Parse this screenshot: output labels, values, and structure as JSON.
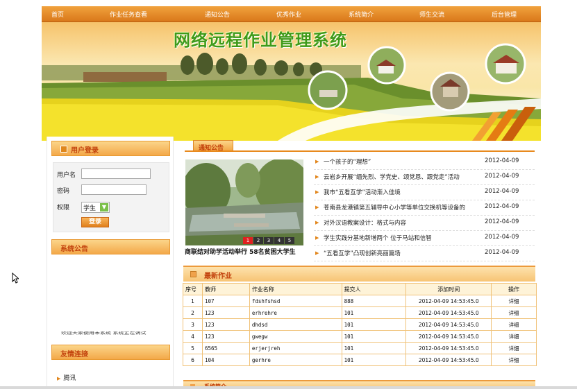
{
  "nav": {
    "items": [
      "首页",
      "作业任务查看",
      "通知公告",
      "优秀作业",
      "系统简介",
      "师生交流",
      "后台管理"
    ]
  },
  "banner": {
    "title": "网络远程作业管理系统"
  },
  "login": {
    "title": "用户登录",
    "username_label": "用户名",
    "password_label": "密码",
    "role_label": "权限",
    "role_value": "学生",
    "button": "登录"
  },
  "system_notice": {
    "title": "系统公告",
    "text": "欢迎大家使用本系统   系统正在调试"
  },
  "links": {
    "title": "友情连接",
    "items": [
      "腾讯"
    ]
  },
  "notice": {
    "tab": "通知公告",
    "photo_caption": "商联结对助学活动举行 58名贫困大学生",
    "slides": [
      "1",
      "2",
      "3",
      "4",
      "5"
    ],
    "items": [
      {
        "title": "一个孩子的“理想”",
        "date": "2012-04-09"
      },
      {
        "title": "云岩乡开展“缅先烈、学党史、颂党恩、跟党走”活动",
        "date": "2012-04-09"
      },
      {
        "title": "我市“五看互学”活动渐入佳境",
        "date": "2012-04-09"
      },
      {
        "title": "苍南县龙港镇第五辅导中心小学等单位交换机等设备的",
        "date": "2012-04-09"
      },
      {
        "title": "对外汉语教案设计：格式与内容",
        "date": "2012-04-09"
      },
      {
        "title": "学生实践分基地新增两个 位于马站和信智",
        "date": "2012-04-09"
      },
      {
        "title": "“五看互学”凸现创新亮丽篇场",
        "date": "2012-04-09"
      }
    ]
  },
  "works": {
    "title": "最新作业",
    "headers": [
      "序号",
      "教师",
      "作业名称",
      "提交人",
      "添加时间",
      "操作"
    ],
    "rows": [
      [
        "1",
        "107",
        "fdshfshsd",
        "888",
        "2012-04-09 14:53:45.0",
        "详细"
      ],
      [
        "2",
        "123",
        "erhrehre",
        "101",
        "2012-04-09 14:53:45.0",
        "详细"
      ],
      [
        "3",
        "123",
        "dhdsd",
        "101",
        "2012-04-09 14:53:45.0",
        "详细"
      ],
      [
        "4",
        "123",
        "gwegw",
        "101",
        "2012-04-09 14:53:45.0",
        "详细"
      ],
      [
        "5",
        "6565",
        "erjerjreh",
        "101",
        "2012-04-09 14:53:45.0",
        "详细"
      ],
      [
        "6",
        "104",
        "gerhre",
        "101",
        "2012-04-09 14:53:45.0",
        "详细"
      ]
    ]
  },
  "bottom_section": {
    "title": "系统简介"
  },
  "colors": {
    "accent": "#e88a1e",
    "title_green": "#3f9a1a",
    "header_text": "#c2410c"
  }
}
